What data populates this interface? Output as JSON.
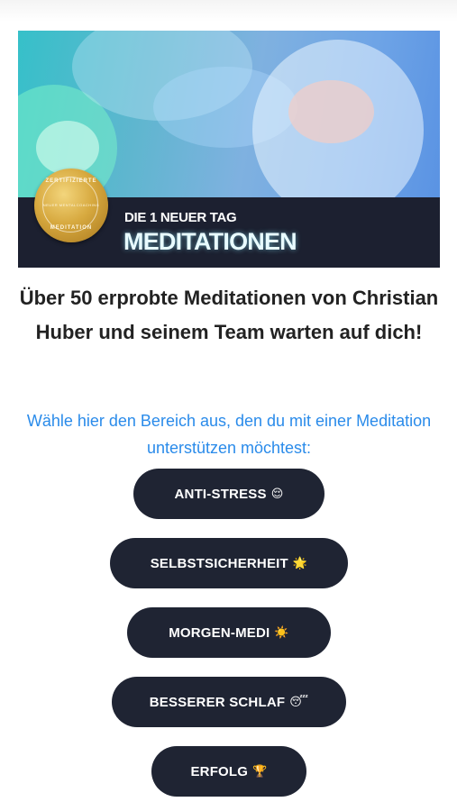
{
  "hero": {
    "subtitle": "DIE 1 NEUER TAG",
    "title": "MEDITATIONEN",
    "seal": {
      "top_text": "ZERTIFIZIERTE",
      "middle_text": "NEUER MENTALCOACHING",
      "bottom_text": "MEDITATION"
    }
  },
  "headline": "Über 50 erprobte Meditationen von Christian Huber und seinem Team warten auf dich!",
  "prompt": "Wähle hier den Bereich aus, den du mit einer Meditation unterstützen möchtest:",
  "buttons": [
    {
      "label": "ANTI-STRESS",
      "emoji": "😌"
    },
    {
      "label": "SELBSTSICHERHEIT",
      "emoji": "🌟"
    },
    {
      "label": "MORGEN-MEDI",
      "emoji": "☀️"
    },
    {
      "label": "BESSERER SCHLAF",
      "emoji": "😴"
    },
    {
      "label": "ERFOLG",
      "emoji": "🏆"
    }
  ],
  "colors": {
    "button_bg": "#1f2433",
    "prompt_text": "#2a8bea",
    "headline_text": "#222222"
  }
}
